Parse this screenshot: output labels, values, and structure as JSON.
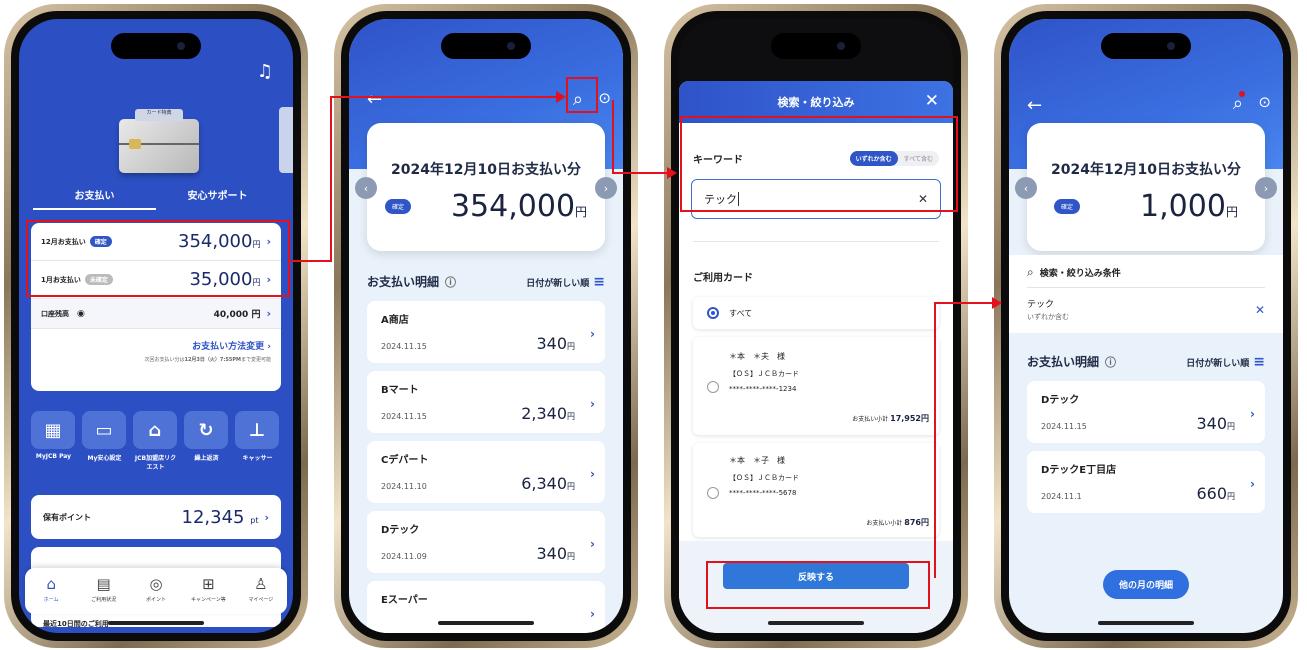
{
  "phone1": {
    "tabs": [
      "お支払い",
      "安心サポート"
    ],
    "card_label": "カード特典",
    "rows": [
      {
        "label": "12月お支払い",
        "badge": "確定",
        "amount": "354,000",
        "unit": "円"
      },
      {
        "label": "1月お支払い",
        "badge": "未確定",
        "amount": "35,000",
        "unit": "円"
      }
    ],
    "balance": {
      "label": "口座残高",
      "amount": "40,000",
      "unit": "円"
    },
    "change_method": {
      "label": "お支払い方法変更",
      "note_prefix": "次回お支払い分は",
      "note_date": "12月3日（火）7:55PM",
      "note_suffix": "まで変更可能"
    },
    "icons": [
      {
        "label": "MyJCB Pay",
        "icon": "qr-icon"
      },
      {
        "label": "My安心設定",
        "icon": "card-shield-icon"
      },
      {
        "label": "JCB加盟店リクエスト",
        "icon": "shop-icon"
      },
      {
        "label": "繰上返済",
        "icon": "refresh-icon"
      },
      {
        "label": "キャッサー",
        "icon": "bank-icon"
      }
    ],
    "points": {
      "label": "保有ポイント",
      "amount": "12,345",
      "unit": "pt"
    },
    "recent_label": "最近10日間のご利用",
    "nav": [
      {
        "label": "ホーム",
        "glyph": "⌂"
      },
      {
        "label": "ご利用状況",
        "glyph": "▤"
      },
      {
        "label": "ポイント",
        "glyph": "◎"
      },
      {
        "label": "キャンペーン等",
        "glyph": "⊞"
      },
      {
        "label": "マイページ",
        "glyph": "♙"
      }
    ]
  },
  "phone2": {
    "summary": {
      "title": "2024年12月10日お支払い分",
      "status": "確定",
      "amount": "354,000",
      "unit": "円"
    },
    "list_title": "お支払い明細",
    "sort_label": "日付が新しい順",
    "items": [
      {
        "name": "A商店",
        "date": "2024.11.15",
        "amount": "340",
        "unit": "円"
      },
      {
        "name": "Bマート",
        "date": "2024.11.15",
        "amount": "2,340",
        "unit": "円"
      },
      {
        "name": "Cデパート",
        "date": "2024.11.10",
        "amount": "6,340",
        "unit": "円"
      },
      {
        "name": "Dテック",
        "date": "2024.11.09",
        "amount": "340",
        "unit": "円"
      },
      {
        "name": "Eスーパー",
        "date": "",
        "amount": "",
        "unit": ""
      }
    ]
  },
  "phone3": {
    "title": "検索・絞り込み",
    "keyword_label": "キーワード",
    "seg": [
      "いずれか含む",
      "すべて含む"
    ],
    "keyword_value": "テック",
    "card_section": "ご利用カード",
    "all_label": "すべて",
    "cards": [
      {
        "holder": "＊本　＊夫　様",
        "card": "【ＯＳ】ＪＣＢカード",
        "number": "****-****-****-1234",
        "subtotal_label": "お支払い小計",
        "subtotal": "17,952円"
      },
      {
        "holder": "＊本　＊子　様",
        "card": "【ＯＳ】ＪＣＢカード",
        "number": "****-****-****-5678",
        "subtotal_label": "お支払い小計",
        "subtotal": "876円"
      }
    ],
    "apply": "反映する"
  },
  "phone4": {
    "summary": {
      "title": "2024年12月10日お支払い分",
      "status": "確定",
      "amount": "1,000",
      "unit": "円"
    },
    "filter_title": "検索・絞り込み条件",
    "filter_value": "テック",
    "filter_mode": "いずれか含む",
    "list_title": "お支払い明細",
    "sort_label": "日付が新しい順",
    "items": [
      {
        "name": "Dテック",
        "date": "2024.11.15",
        "amount": "340",
        "unit": "円"
      },
      {
        "name": "DテックE丁目店",
        "date": "2024.11.1",
        "amount": "660",
        "unit": "円"
      }
    ],
    "other_months": "他の月の明細"
  },
  "colors": {
    "accent": "#2f55c7",
    "highlight": "#e3111b"
  }
}
